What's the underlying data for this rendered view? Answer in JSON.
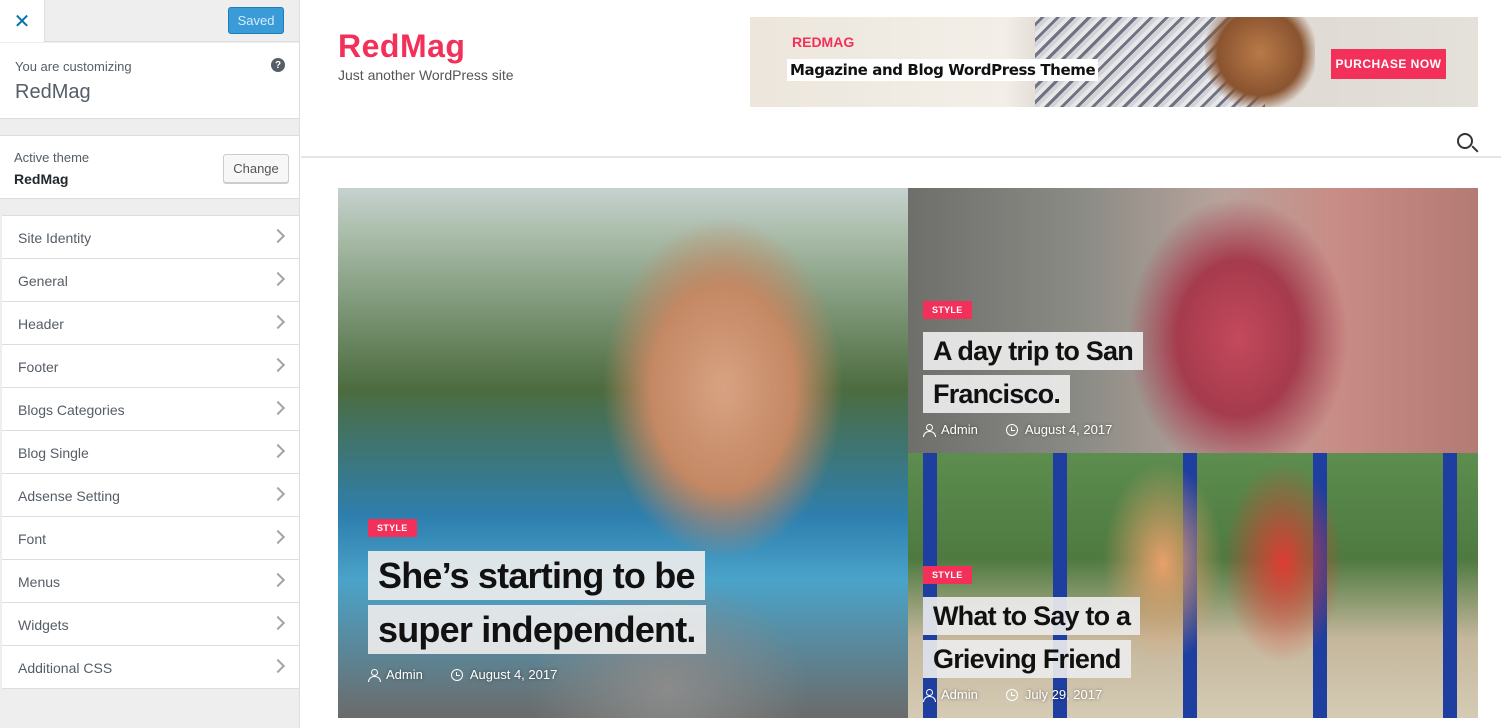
{
  "customizer": {
    "close_icon": "close-icon",
    "saved_label": "Saved",
    "customizing_label": "You are customizing",
    "site_name": "RedMag",
    "help_icon": "?",
    "active_theme_label": "Active theme",
    "active_theme_name": "RedMag",
    "change_label": "Change",
    "sections": [
      {
        "label": "Site Identity"
      },
      {
        "label": "General"
      },
      {
        "label": "Header"
      },
      {
        "label": "Footer"
      },
      {
        "label": "Blogs Categories"
      },
      {
        "label": "Blog Single"
      },
      {
        "label": "Adsense Setting"
      },
      {
        "label": "Font"
      },
      {
        "label": "Menus"
      },
      {
        "label": "Widgets"
      },
      {
        "label": "Additional CSS"
      }
    ]
  },
  "site": {
    "title": "RedMag",
    "tagline": "Just another WordPress site",
    "accent_color": "#f2305a"
  },
  "ad": {
    "brand": "REDMAG",
    "text": "Magazine and Blog WordPress Theme",
    "button": "PURCHASE NOW"
  },
  "posts": [
    {
      "tag": "STYLE",
      "title": "She’s starting to be super independent.",
      "author": "Admin",
      "date": "August 4, 2017"
    },
    {
      "tag": "STYLE",
      "title": "A day trip to San Francisco.",
      "author": "Admin",
      "date": "August 4, 2017"
    },
    {
      "tag": "STYLE",
      "title": "What to Say to a Grieving Friend",
      "author": "Admin",
      "date": "July 29, 2017"
    }
  ]
}
